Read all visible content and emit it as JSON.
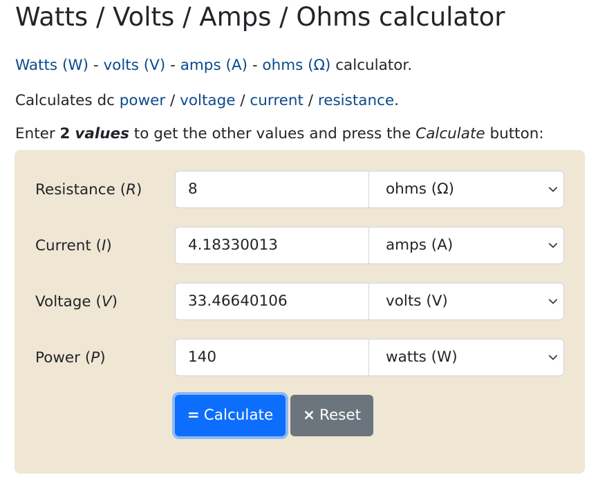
{
  "title": "Watts / Volts / Amps / Ohms calculator",
  "intro": {
    "link_watts": "Watts (W)",
    "sep1": " - ",
    "link_volts": "volts (V)",
    "sep2": " - ",
    "link_amps": "amps (A)",
    "sep3": " - ",
    "link_ohms": "ohms (Ω)",
    "suffix": " calculator."
  },
  "description": {
    "prefix": "Calculates dc ",
    "link_power": "power",
    "sep1": " / ",
    "link_voltage": "voltage",
    "sep2": " / ",
    "link_current": "current",
    "sep3": " / ",
    "link_resistance": "resistance",
    "suffix": "."
  },
  "instruction": {
    "prefix": "Enter ",
    "bold_num": "2",
    "bold_values": "values",
    "middle": " to get the other values and press the ",
    "italic_calc": "Calculate",
    "suffix": " button:"
  },
  "form": {
    "rows": [
      {
        "label": "Resistance (",
        "symbol": "R",
        "close": ")",
        "value": "8",
        "unit": "ohms (Ω)"
      },
      {
        "label": "Current (",
        "symbol": "I",
        "close": ")",
        "value": "4.18330013",
        "unit": "amps (A)"
      },
      {
        "label": "Voltage (",
        "symbol": "V",
        "close": ")",
        "value": "33.46640106",
        "unit": "volts (V)"
      },
      {
        "label": "Power (",
        "symbol": "P",
        "close": ")",
        "value": "140",
        "unit": "watts (W)"
      }
    ],
    "calculate_icon": "=",
    "calculate_label": "Calculate",
    "reset_icon": "×",
    "reset_label": "Reset"
  },
  "colors": {
    "link": "#0a4a8c",
    "panel_bg": "#efe7d4",
    "calculate_bg": "#0d6efd",
    "reset_bg": "#6c757d"
  },
  "icons": {
    "select_arrow": "chevron-down-icon"
  }
}
